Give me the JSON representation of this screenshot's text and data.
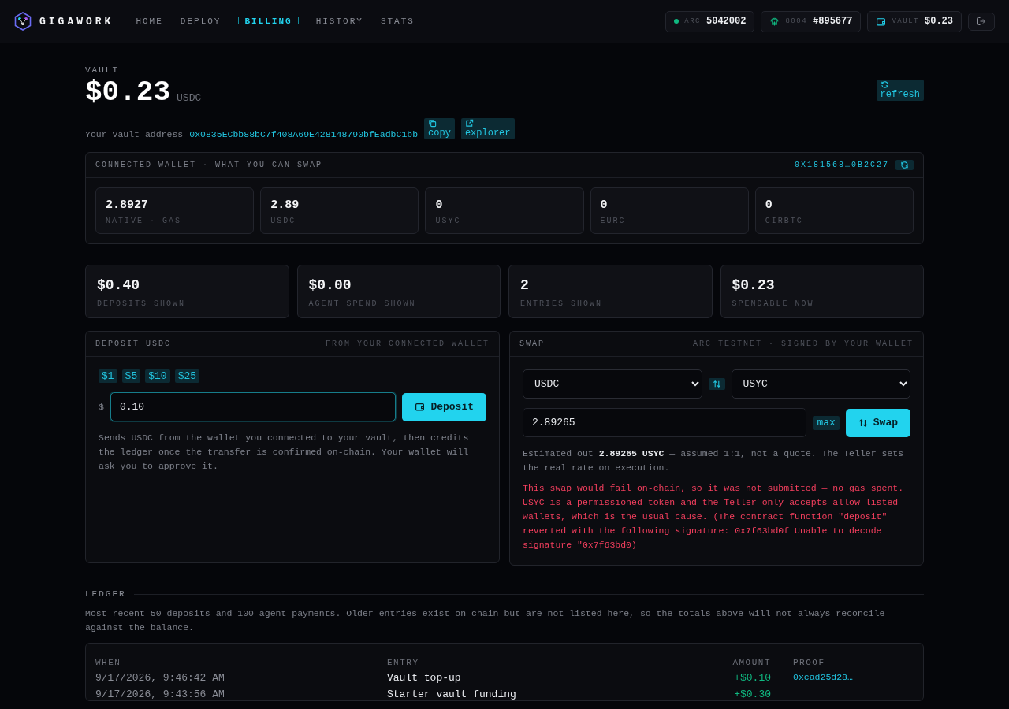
{
  "brand": "GIGAWORK",
  "nav": [
    {
      "label": "HOME",
      "selected": false
    },
    {
      "label": "DEPLOY",
      "selected": false
    },
    {
      "label": "BILLING",
      "selected": true
    },
    {
      "label": "HISTORY",
      "selected": false
    },
    {
      "label": "STATS",
      "selected": false
    }
  ],
  "status": [
    {
      "kind": "dot",
      "label": "ARC",
      "value": "5042002",
      "color": "#10b981"
    },
    {
      "kind": "fingerprint",
      "label": "8004",
      "value": "#895677"
    },
    {
      "kind": "wallet",
      "label": "VAULT",
      "value": "$0.23"
    }
  ],
  "vault": {
    "label": "VAULT",
    "amount": "$0.23",
    "unit": "USDC",
    "refresh": "refresh",
    "address_label": "Your vault address",
    "address": "0x0835ECbb88bC7f408A69E428148790bfEadbC1bb",
    "copy": "copy",
    "explorer": "explorer"
  },
  "wallet": {
    "title": "CONNECTED WALLET · WHAT YOU CAN SWAP",
    "address": "0X181568…0B2C27",
    "balances": [
      {
        "value": "2.8927",
        "label": "NATIVE · GAS"
      },
      {
        "value": "2.89",
        "label": "USDC"
      },
      {
        "value": "0",
        "label": "USYC"
      },
      {
        "value": "0",
        "label": "EURC"
      },
      {
        "value": "0",
        "label": "CIRBTC"
      }
    ]
  },
  "stats": [
    {
      "value": "$0.40",
      "label": "DEPOSITS SHOWN"
    },
    {
      "value": "$0.00",
      "label": "AGENT SPEND SHOWN"
    },
    {
      "value": "2",
      "label": "ENTRIES SHOWN"
    },
    {
      "value": "$0.23",
      "label": "SPENDABLE NOW"
    }
  ],
  "deposit": {
    "title": "DEPOSIT USDC",
    "subtitle": "FROM YOUR CONNECTED WALLET",
    "presets": [
      "$1",
      "$5",
      "$10",
      "$25"
    ],
    "currency": "$",
    "value": "0.10",
    "button": "Deposit",
    "note": "Sends USDC from the wallet you connected to your vault, then credits the ledger once the transfer is confirmed on-chain. Your wallet will ask you to approve it."
  },
  "swap": {
    "title": "SWAP",
    "subtitle": "ARC TESTNET · SIGNED BY YOUR WALLET",
    "from": "USDC",
    "to": "USYC",
    "amount": "2.89265",
    "max": "max",
    "button": "Swap",
    "estimate": "Estimated out **2.89265 USYC** — assumed 1:1, not a quote. The Teller sets the real rate on execution.",
    "error": "This swap would fail on-chain, so it was not submitted — no gas spent. USYC is a permissioned token and the Teller only accepts allow-listed wallets, which is the usual cause. (The contract function \"deposit\" reverted with the following signature: 0x7f63bd0f Unable to decode signature \"0x7f63bd0)"
  },
  "ledger": {
    "title": "LEDGER",
    "note": "Most recent 50 deposits and 100 agent payments. Older entries exist on-chain but are not listed here, so the totals above will not always reconcile against the balance.",
    "columns": [
      "WHEN",
      "ENTRY",
      "AMOUNT",
      "PROOF"
    ],
    "rows": [
      {
        "when": "9/17/2026, 9:46:42 AM",
        "entry": "Vault top-up",
        "amount": "+$0.10",
        "proof": "0xcad25d28…"
      },
      {
        "when": "9/17/2026, 9:43:56 AM",
        "entry": "Starter vault funding",
        "amount": "+$0.30"
      }
    ]
  }
}
